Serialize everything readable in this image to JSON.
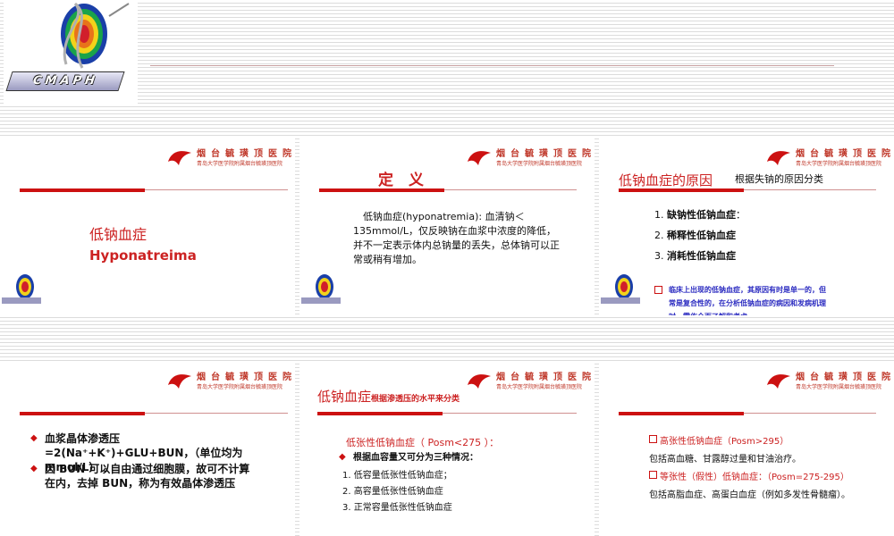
{
  "header": {
    "logo_wordmark": "CMAPH"
  },
  "hospital": {
    "name_line1": "烟台毓璜顶医院",
    "name_line2": "青岛大学医学院附属烟台毓璜顶医院"
  },
  "slide1": {
    "title_cn": "低钠血症",
    "title_en": "Hyponatreima"
  },
  "slide2": {
    "heading": "定　义",
    "body": "低钠血症(hyponatremia): 血清钠＜135mmol/L，仅反映钠在血浆中浓度的降低，并不一定表示体内总钠量的丢失，总体钠可以正常或稍有增加。"
  },
  "slide3": {
    "title": "低钠血症的原因",
    "subtitle": "根据失钠的原因分类",
    "items": [
      {
        "num": "1.",
        "text": "缺钠性低钠血症",
        "suffix": "："
      },
      {
        "num": "2.",
        "text": "稀释性低钠血症",
        "suffix": ""
      },
      {
        "num": "3.",
        "text": "消耗性低钠血症",
        "suffix": ""
      }
    ],
    "note": "临床上出现的低钠血症，其原因有时是单一的，但常是复合性的，在分析低钠血症的病因和发病机理时，需作全面了解和考虑。"
  },
  "slide4": {
    "bullet1": "血浆晶体渗透压 =2(Na⁺+K⁺)+GLU+BUN，（单位均为 mmol/L） 。",
    "bullet2": "因 BUN 可以自由通过细胞膜，故可不计算在内，去掉 BUN，称为有效晶体渗透压"
  },
  "slide5": {
    "title_big": "低钠血症",
    "title_small": "根据渗透压的水平来分类",
    "sub": "低张性低钠血症（ Posm<275 ）：",
    "bullet": "根据血容量又可分为三种情况：",
    "items": [
      "1. 低容量低张性低钠血症；",
      "2. 高容量低张性低钠血症",
      "3. 正常容量低张性低钠血症"
    ]
  },
  "slide6": {
    "item1_label": "高张性低钠血症（Posm>295）",
    "item1_desc": "包括高血糖、甘露醇过量和甘油治疗。",
    "item2_label": "等张性（假性）低钠血症：（Posm=275-295）",
    "item2_desc": "包括高脂血症、高蛋白血症（例如多发性骨髓瘤）。"
  }
}
